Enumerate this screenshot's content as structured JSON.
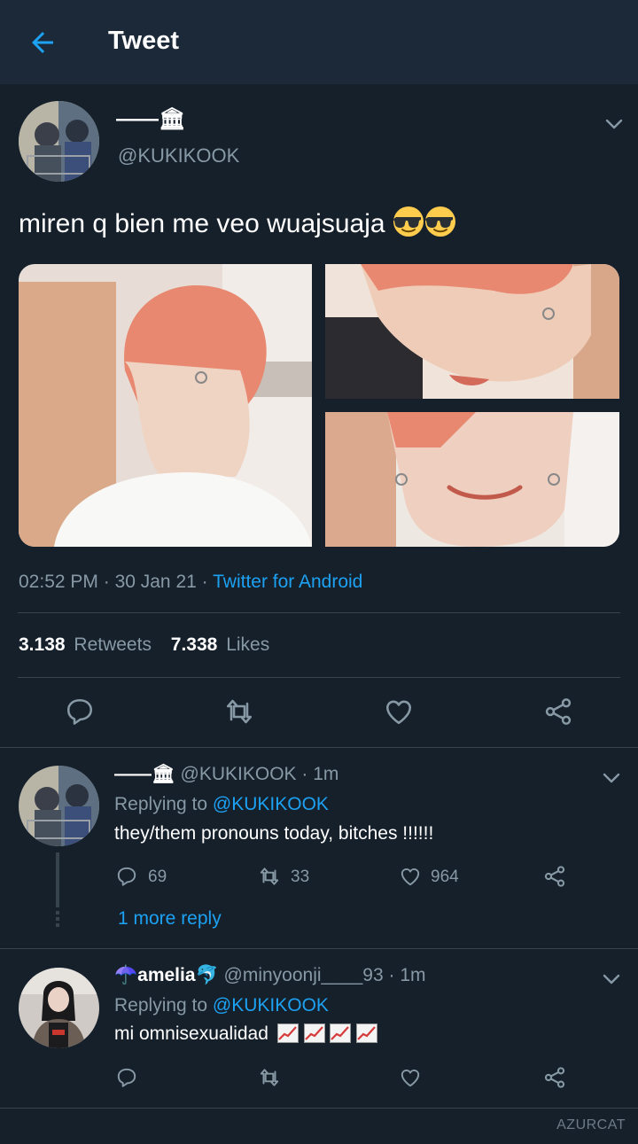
{
  "header": {
    "title": "Tweet"
  },
  "tweet": {
    "display_name": "——🏛",
    "handle": "@KUKIKOOK",
    "text": "miren q bien me veo wuajsuaja",
    "time": "02:52 PM",
    "date": "30 Jan 21",
    "source": "Twitter for Android",
    "retweets_count": "3.138",
    "retweets_label": "Retweets",
    "likes_count": "7.338",
    "likes_label": "Likes"
  },
  "replies": [
    {
      "display_name": "——🏛",
      "handle": "@KUKIKOOK",
      "time": "1m",
      "replying_label": "Replying to",
      "replying_to": "@KUKIKOOK",
      "text": "they/them pronouns today, bitches !!!!!!",
      "reply_count": "69",
      "retweet_count": "33",
      "like_count": "964",
      "more_replies": "1 more reply"
    },
    {
      "display_name": "☂️amelia🐬",
      "handle": "@minyoonji____93",
      "time": "1m",
      "replying_label": "Replying to",
      "replying_to": "@KUKIKOOK",
      "text": "mi omnisexualidad"
    }
  ],
  "watermark": "AZURCAT",
  "colors": {
    "background": "#15202b",
    "header": "#1c2938",
    "accent": "#1da1f2",
    "muted": "#8899a6",
    "divider": "#38444d"
  }
}
